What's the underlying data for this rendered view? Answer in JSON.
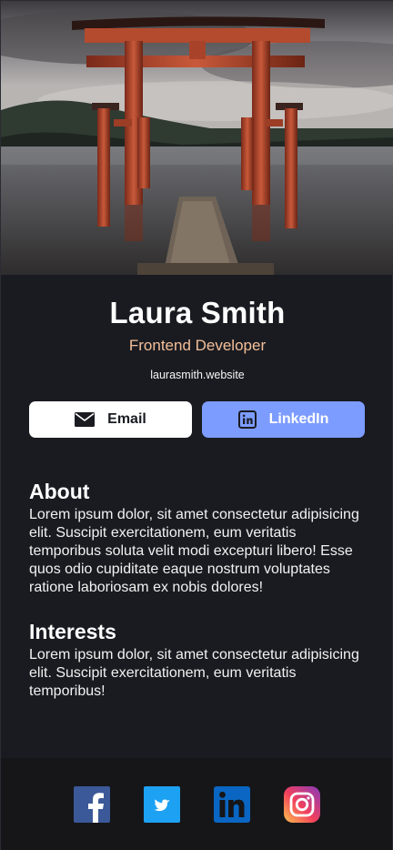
{
  "profile": {
    "name": "Laura Smith",
    "role": "Frontend Developer",
    "website": "laurasmith.website"
  },
  "actions": {
    "email_label": "Email",
    "linkedin_label": "LinkedIn"
  },
  "about": {
    "title": "About",
    "text": "Lorem ipsum dolor, sit amet consectetur adipisicing elit. Suscipit exercitationem, eum veritatis temporibus soluta velit modi excepturi libero! Esse quos odio cupiditate eaque nostrum voluptates ratione laboriosam ex nobis dolores!"
  },
  "interests": {
    "title": "Interests",
    "text": "Lorem ipsum dolor, sit amet consectetur adipisicing elit. Suscipit exercitationem, eum veritatis temporibus!"
  },
  "footer": {
    "icons": [
      "facebook-icon",
      "twitter-icon",
      "linkedin-icon",
      "instagram-icon"
    ]
  },
  "colors": {
    "background": "#1a1b21",
    "accent_role": "#f3bf99",
    "linkedin_button": "#7d9cff",
    "footer": "#161619"
  }
}
